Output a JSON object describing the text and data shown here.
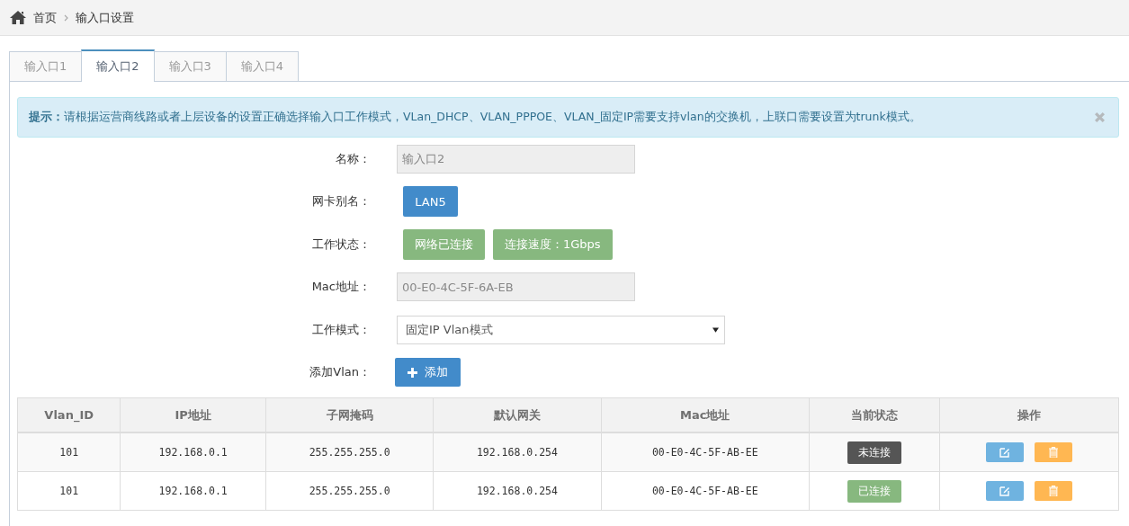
{
  "breadcrumb": {
    "home": "首页",
    "current": "输入口设置"
  },
  "tabs": [
    {
      "label": "输入口1",
      "selected": false
    },
    {
      "label": "输入口2",
      "selected": true
    },
    {
      "label": "输入口3",
      "selected": false
    },
    {
      "label": "输入口4",
      "selected": false
    }
  ],
  "alert": {
    "text": "**提示：**请根据运营商线路或者上层设备的设置正确选择输入口工作模式，VLan_DHCP、VLAN_PPPOE、VLAN_固定IP需要支持vlan的交换机，上联口需要设置为trunk模式。"
  },
  "form": {
    "name_label": "名称：",
    "name_value": "输入口2",
    "alias_label": "网卡别名：",
    "alias": "LAN5",
    "status_label": "工作状态：",
    "status_badges": [
      "网络已连接",
      "连接速度：1Gbps"
    ],
    "mac_label": "Mac地址：",
    "mac_value": "00-E0-4C-5F-6A-EB",
    "mode_label": "工作模式：",
    "mode_value": "固定IP Vlan模式",
    "add_label": "添加Vlan：",
    "add_button": "添加"
  },
  "table": {
    "columns": [
      "Vlan_ID",
      "IP地址",
      "子网掩码",
      "默认网关",
      "Mac地址",
      "当前状态",
      "操作"
    ],
    "rows": [
      {
        "vlan_id": "101",
        "ip": "192.168.0.1",
        "mask": "255.255.255.0",
        "gateway": "192.168.0.254",
        "mac": "00-E0-4C-5F-AB-EE",
        "status": "未连接",
        "connected": false
      },
      {
        "vlan_id": "101",
        "ip": "192.168.0.1",
        "mask": "255.255.255.0",
        "gateway": "192.168.0.254",
        "mac": "00-E0-4C-5F-AB-EE",
        "status": "已连接",
        "connected": true
      }
    ]
  }
}
